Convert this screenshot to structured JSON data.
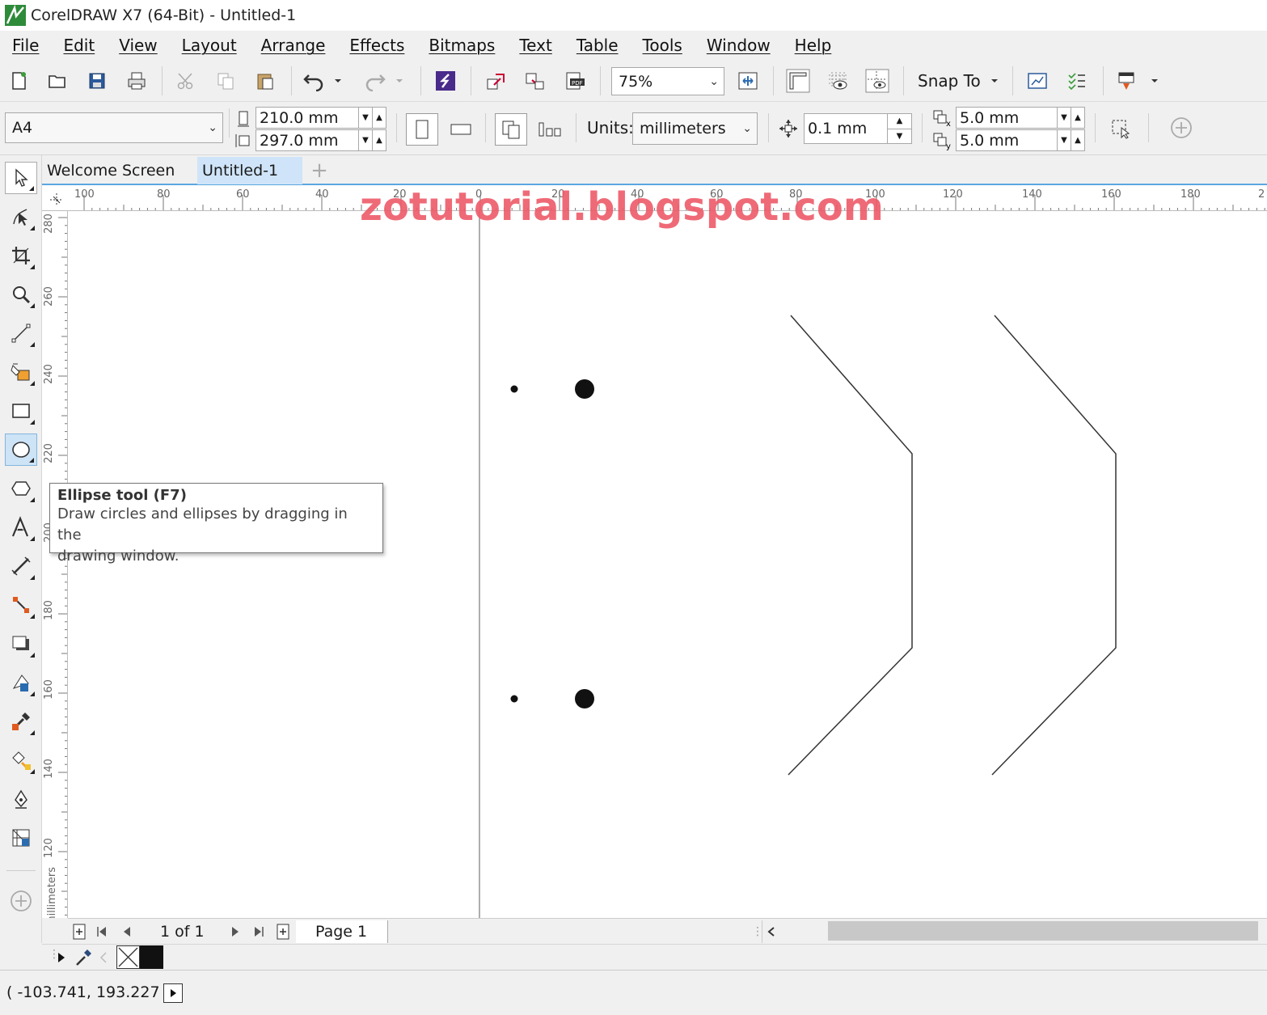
{
  "window": {
    "title": "CorelDRAW X7 (64-Bit) - Untitled-1"
  },
  "menu": [
    "File",
    "Edit",
    "View",
    "Layout",
    "Arrange",
    "Effects",
    "Bitmaps",
    "Text",
    "Table",
    "Tools",
    "Window",
    "Help"
  ],
  "toolbar": {
    "zoom": "75%",
    "snap_to": "Snap To"
  },
  "property_bar": {
    "page_size": "A4",
    "width": "210.0 mm",
    "height": "297.0 mm",
    "units_label": "Units:",
    "units": "millimeters",
    "nudge": "0.1 mm",
    "dup_x": "5.0 mm",
    "dup_y": "5.0 mm"
  },
  "tabs": [
    "Welcome Screen",
    "Untitled-1"
  ],
  "ruler": {
    "h_labels": [
      "100",
      "80",
      "60",
      "40",
      "20",
      "0",
      "20",
      "40",
      "60",
      "80",
      "100",
      "120",
      "140",
      "160",
      "180",
      "2"
    ],
    "v_labels": [
      "280",
      "260",
      "240",
      "220",
      "200",
      "180",
      "160",
      "140",
      "120"
    ],
    "v_unit": "millimeters"
  },
  "tooltip": {
    "title": "Ellipse tool (F7)",
    "line1": "Draw circles and ellipses by dragging in the",
    "line2": "drawing window."
  },
  "watermark": "zotutorial.blogspot.com",
  "page_nav": {
    "count": "1 of 1",
    "page_tab": "Page 1"
  },
  "status": {
    "coords": "( -103.741, 193.227 )"
  },
  "colors": {
    "accent": "#5ba7e0",
    "watermark": "#ee5a69",
    "tooltip_border": "#767676"
  }
}
